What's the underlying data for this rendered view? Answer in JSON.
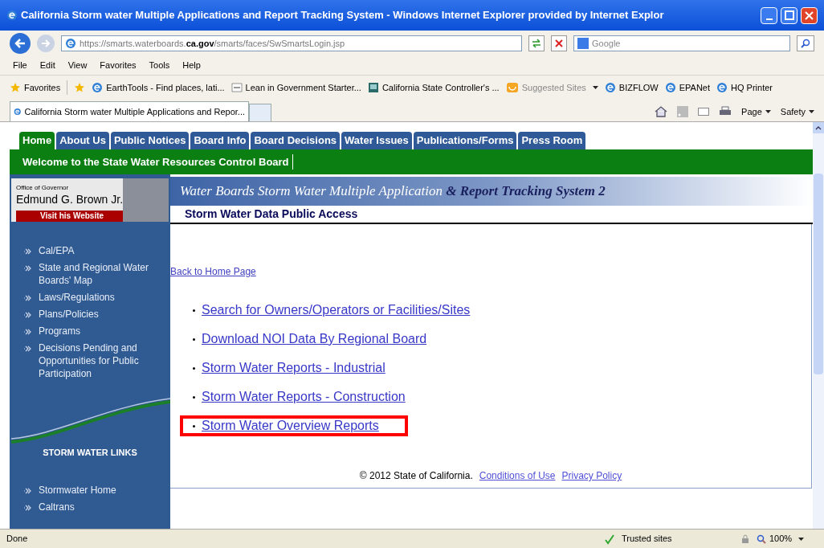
{
  "window": {
    "title": "California Storm water Multiple Applications and Report Tracking System - Windows Internet Explorer provided by Internet Explor"
  },
  "address": {
    "url_start": "https://smarts.waterboards.",
    "url_domain": "ca.gov",
    "url_end": "/smarts/faces/SwSmartsLogin.jsp"
  },
  "search": {
    "placeholder": "Google"
  },
  "menu": [
    "File",
    "Edit",
    "View",
    "Favorites",
    "Tools",
    "Help"
  ],
  "favorites_bar": {
    "label": "Favorites",
    "items": [
      {
        "label": "EarthTools - Find places, lati...",
        "kind": "ie"
      },
      {
        "label": "Lean in Government Starter...",
        "kind": "epa"
      },
      {
        "label": "California State Controller's ...",
        "kind": "sco"
      },
      {
        "label": "Suggested Sites",
        "kind": "suggested"
      },
      {
        "label": "BIZFLOW",
        "kind": "ie"
      },
      {
        "label": "EPANet",
        "kind": "ie"
      },
      {
        "label": "HQ Printer",
        "kind": "ie"
      }
    ]
  },
  "browser_tab": {
    "title": "California Storm water Multiple Applications and Repor..."
  },
  "command_bar": [
    "Page",
    "Safety"
  ],
  "page": {
    "nav_tabs": [
      {
        "label": "Home",
        "selected": true
      },
      {
        "label": "About Us",
        "selected": false
      },
      {
        "label": "Public Notices",
        "selected": false
      },
      {
        "label": "Board Info",
        "selected": false
      },
      {
        "label": "Board Decisions",
        "selected": false
      },
      {
        "label": "Water Issues",
        "selected": false
      },
      {
        "label": "Publications/Forms",
        "selected": false
      },
      {
        "label": "Press Room",
        "selected": false
      }
    ],
    "welcome": "Welcome to the State Water Resources Control Board",
    "governor": {
      "office": "Office of Governor",
      "name": "Edmund G. Brown Jr.",
      "link": "Visit his Website"
    },
    "sidebar_links": [
      "Cal/EPA",
      "State and Regional Water Boards' Map",
      "Laws/Regulations",
      "Plans/Policies",
      "Programs",
      "Decisions Pending and Opportunities for Public Participation"
    ],
    "storm_links_heading": "STORM WATER LINKS",
    "storm_links": [
      "Stormwater Home",
      "Caltrans"
    ],
    "banner": {
      "part_1": "Water Boards  Storm Water Multiple Application",
      "part_2": "& Report Tracking System 2"
    },
    "section_title": "Storm Water Data Public Access",
    "back_link": "Back to Home Page",
    "links": [
      {
        "label": "Search for Owners/Operators or Facilities/Sites",
        "highlighted": false
      },
      {
        "label": "Download NOI Data By Regional Board",
        "highlighted": false
      },
      {
        "label": "Storm Water Reports - Industrial",
        "highlighted": false
      },
      {
        "label": "Storm Water Reports - Construction",
        "highlighted": false
      },
      {
        "label": "Storm Water Overview Reports",
        "highlighted": true
      }
    ],
    "footer": {
      "copyright": "© 2012 State of California.",
      "links": [
        "Conditions of Use",
        "Privacy Policy"
      ]
    }
  },
  "status_bar": {
    "text": "Done",
    "zone": "Trusted sites",
    "zoom": "100%"
  }
}
